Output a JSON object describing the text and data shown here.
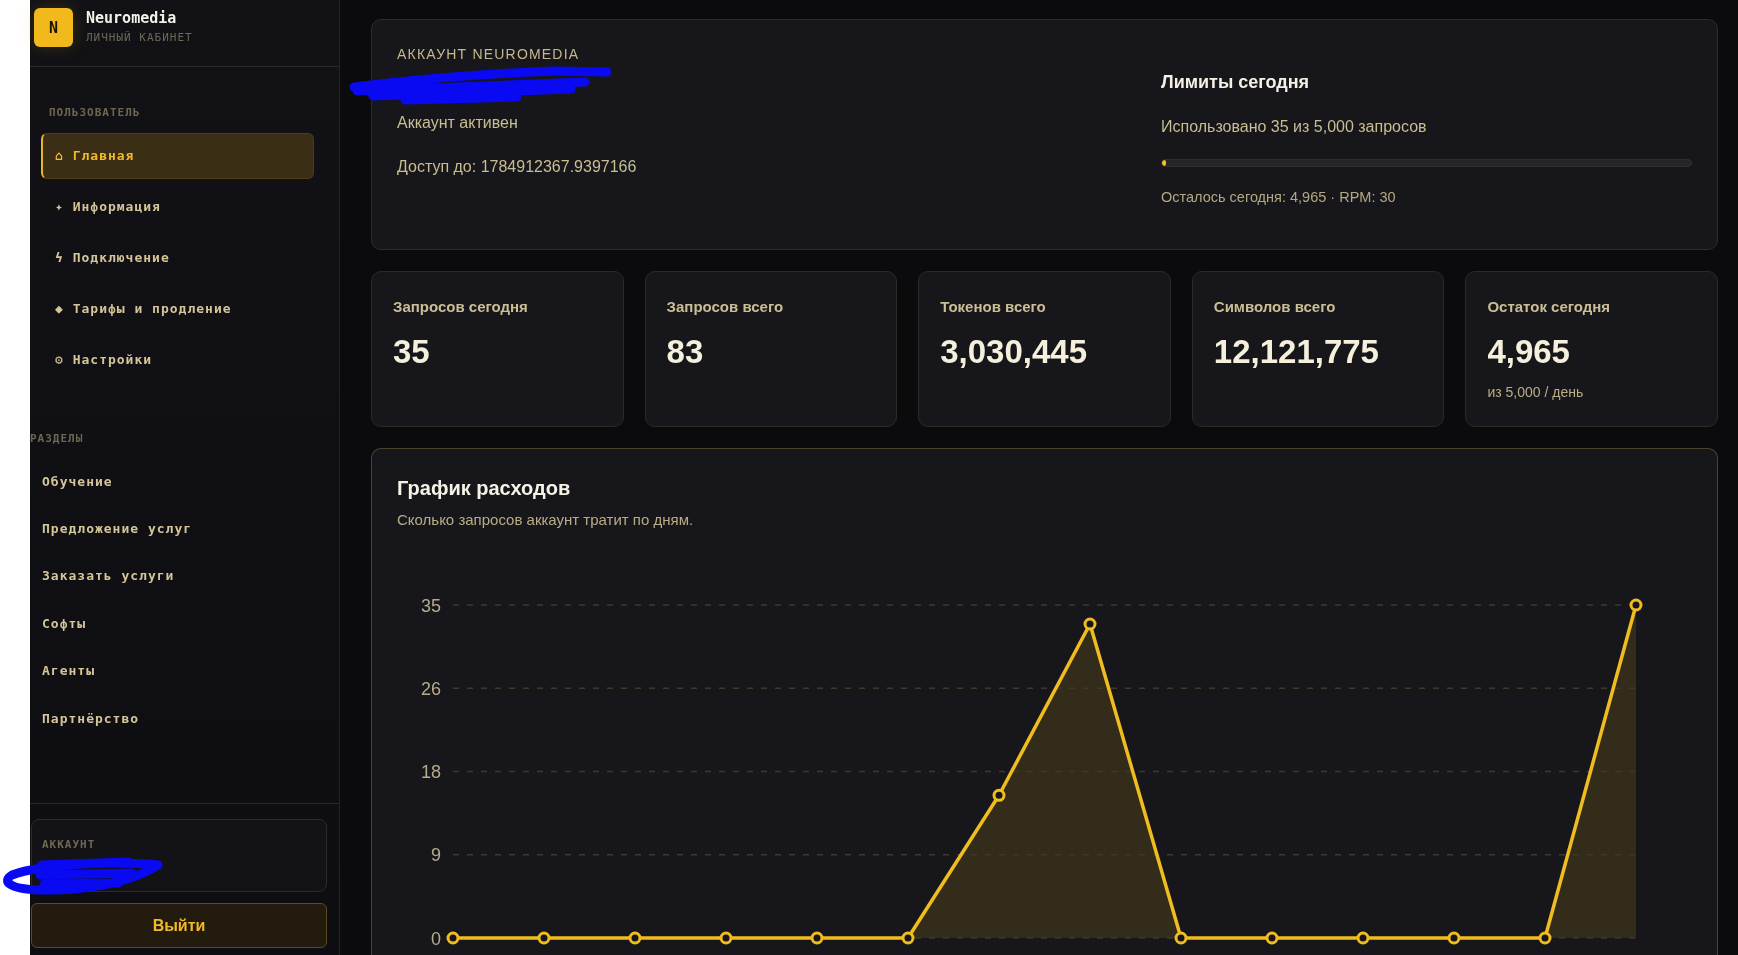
{
  "sidebar": {
    "brand": {
      "logo": "N",
      "title": "Neuromedia",
      "subtitle": "ЛИЧНЫЙ КАБИНЕТ"
    },
    "user_section": {
      "heading": "ПОЛЬЗОВАТЕЛЬ",
      "items": [
        {
          "label": "⌂ Главная",
          "selected": true
        },
        {
          "label": "✦ Информация",
          "selected": false
        },
        {
          "label": "ϟ Подключение",
          "selected": false
        },
        {
          "label": "◆ Тарифы и продление",
          "selected": false
        },
        {
          "label": "⚙ Настройки",
          "selected": false
        }
      ]
    },
    "sections": {
      "heading": "РАЗДЕЛЫ",
      "items": [
        {
          "label": "Обучение",
          "selected": false
        },
        {
          "label": "Предложение услуг",
          "selected": false
        },
        {
          "label": "Заказать услуги",
          "selected": false
        },
        {
          "label": "Софты",
          "selected": false
        },
        {
          "label": "Агенты",
          "selected": false
        },
        {
          "label": "Партнёрство",
          "selected": false
        }
      ]
    },
    "account": {
      "label": "АККАУНТ"
    },
    "logout_button": "Выйти"
  },
  "account_card": {
    "eyebrow": "АККАУНТ NEUROMEDIA",
    "status": "Аккаунт активен",
    "access": "Доступ до: 1784912367.9397166",
    "limits": {
      "title": "Лимиты сегодня",
      "usage": "Использовано 35 из 5,000 запросов",
      "level": 0.007,
      "remaining": "Осталось сегодня: 4,965 · RPM: 30"
    }
  },
  "stats": [
    {
      "label": "Запросов сегодня",
      "value": "35"
    },
    {
      "label": "Запросов всего",
      "value": "83"
    },
    {
      "label": "Токенов всего",
      "value": "3,030,445"
    },
    {
      "label": "Символов всего",
      "value": "12,121,775"
    },
    {
      "label": "Остаток сегодня",
      "value": "4,965",
      "note": "из 5,000 / день"
    }
  ],
  "chart_panel": {
    "title": "График расходов",
    "subtitle": "Сколько запросов аккаунт тратит по дням.",
    "chart_data": {
      "type": "area",
      "series": [
        {
          "color": "#f0bd1e",
          "values": [
            0,
            0,
            0,
            0,
            0,
            0,
            15,
            33,
            0,
            0,
            0,
            0,
            0,
            35
          ]
        }
      ],
      "ylim": [
        0,
        35
      ],
      "yticks": [
        0,
        {
          "value": 8.75,
          "label": "9"
        },
        {
          "value": 17.5,
          "label": "18"
        },
        {
          "value": 26.25,
          "label": "26"
        },
        35
      ],
      "grid": true
    }
  }
}
